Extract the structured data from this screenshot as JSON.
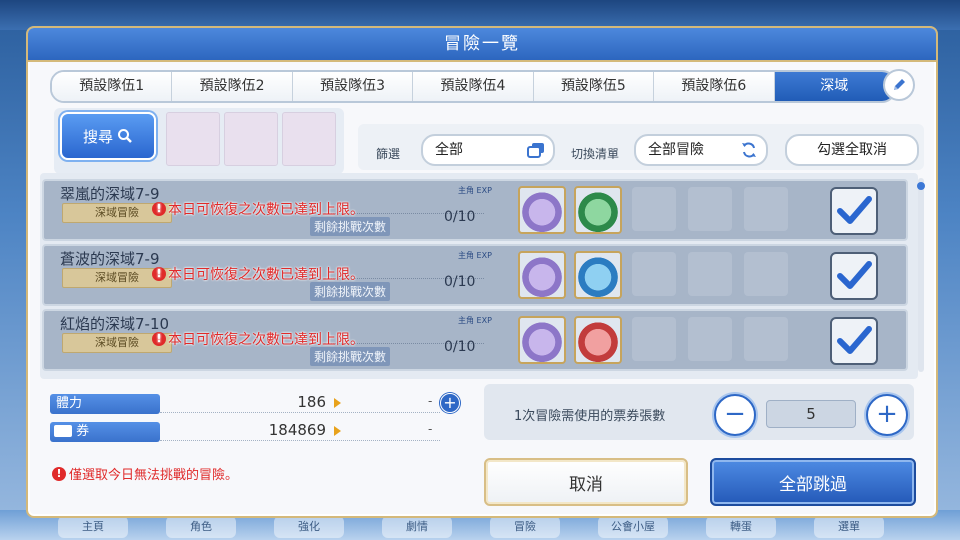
{
  "background_nav": [
    "主頁",
    "角色",
    "強化",
    "劇情",
    "冒險",
    "公會小屋",
    "轉蛋",
    "選單"
  ],
  "dialog": {
    "title": "冒險一覽",
    "tabs": [
      "預設隊伍1",
      "預設隊伍2",
      "預設隊伍3",
      "預設隊伍4",
      "預設隊伍5",
      "預設隊伍6",
      "深域"
    ],
    "active_tab": 6,
    "search_label": "搜尋",
    "filter": {
      "filter_label": "篩選",
      "filter_value": "全部",
      "switch_label": "切換清單",
      "switch_value": "全部冒險",
      "deselect_all": "勾選全取消"
    },
    "warning_text": "本日可恢復之次數已達到上限。",
    "rows": [
      {
        "name": "翠嵐的深域7-9",
        "badge": "深域冒險",
        "remain_label": "剩餘挑戰次數",
        "count": "0/10",
        "exp": "主角 EXP",
        "items": [
          "purple",
          "green"
        ]
      },
      {
        "name": "蒼波的深域7-9",
        "badge": "深域冒險",
        "remain_label": "剩餘挑戰次數",
        "count": "0/10",
        "exp": "主角 EXP",
        "items": [
          "purple",
          "blue"
        ]
      },
      {
        "name": "紅焰的深域7-10",
        "badge": "深域冒險",
        "remain_label": "剩餘挑戰次數",
        "count": "0/10",
        "exp": "主角 EXP",
        "items": [
          "purple",
          "red"
        ]
      }
    ],
    "stamina": {
      "label": "體力",
      "value": "186",
      "after": "-"
    },
    "ticket": {
      "label": "券",
      "value": "184869",
      "after": "-"
    },
    "ticket_use_label": "1次冒險需使用的票券張數",
    "ticket_count": "5",
    "minus_symbol": "−",
    "plus_symbol": "+",
    "note": "僅選取今日無法挑戰的冒險。",
    "cancel_label": "取消",
    "skip_all_label": "全部跳過"
  },
  "colors": {
    "accent": "#2a66cf",
    "warning": "#e02a2a",
    "gold": "#d4b97a"
  }
}
